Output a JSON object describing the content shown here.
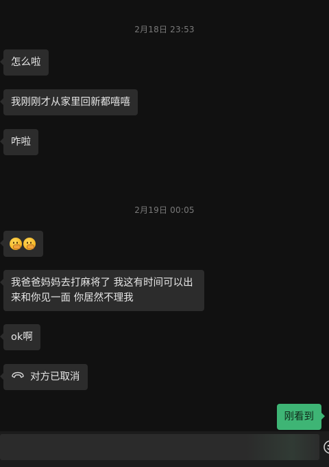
{
  "chat": {
    "timestamp_1": "2月18日 23:53",
    "timestamp_2": "2月19日 00:05",
    "messages": [
      {
        "text": "怎么啦"
      },
      {
        "text": "我刚刚才从家里回新都嘻嘻"
      },
      {
        "text": "咋啦"
      },
      {
        "emoji": [
          "face-with-hand-over-mouth-emoji",
          "face-with-hand-over-mouth-emoji"
        ]
      },
      {
        "text": "我爸爸妈妈去打麻将了 我这有时间可以出来和你见一面 你居然不理我"
      },
      {
        "text": "ok啊"
      },
      {
        "text": "对方已取消",
        "icon": "phone-hangup-icon"
      },
      {
        "text": "刚看到",
        "side": "right"
      }
    ]
  },
  "colors": {
    "background": "#111111",
    "bubble_incoming": "#2c2c2c",
    "bubble_outgoing": "#3eb575",
    "timestamp_text": "#7a7a7a"
  },
  "input_bar": {
    "emoji_button_icon": "smiley-icon"
  }
}
